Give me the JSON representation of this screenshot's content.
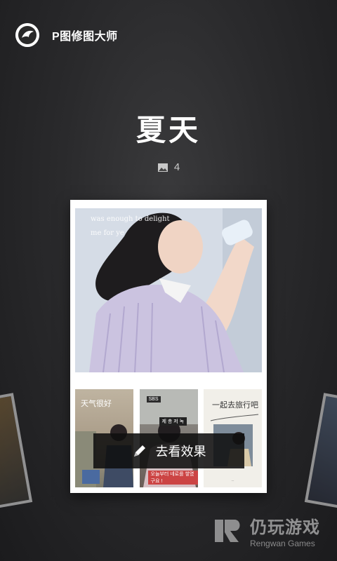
{
  "header": {
    "app_name": "P图修图大师",
    "logo_icon": "app-logo-icon"
  },
  "album": {
    "title": "夏天",
    "photo_count": "4",
    "count_icon": "image-icon"
  },
  "card": {
    "hero_lines": [
      "was enough to delight",
      "me for ye"
    ],
    "thumbnails": [
      {
        "label": "天气很好"
      },
      {
        "tag": "SBS",
        "tag2": "제 총 저 녹",
        "caption": "오늘부터 네로를 쌓였구요 !"
      },
      {
        "label": "一起去旅行吧",
        "small": "..."
      }
    ]
  },
  "cta": {
    "label": "去看效果",
    "icon": "pencil-icon"
  },
  "watermark": {
    "cn": "仍玩游戏",
    "en": "Rengwan Games"
  }
}
